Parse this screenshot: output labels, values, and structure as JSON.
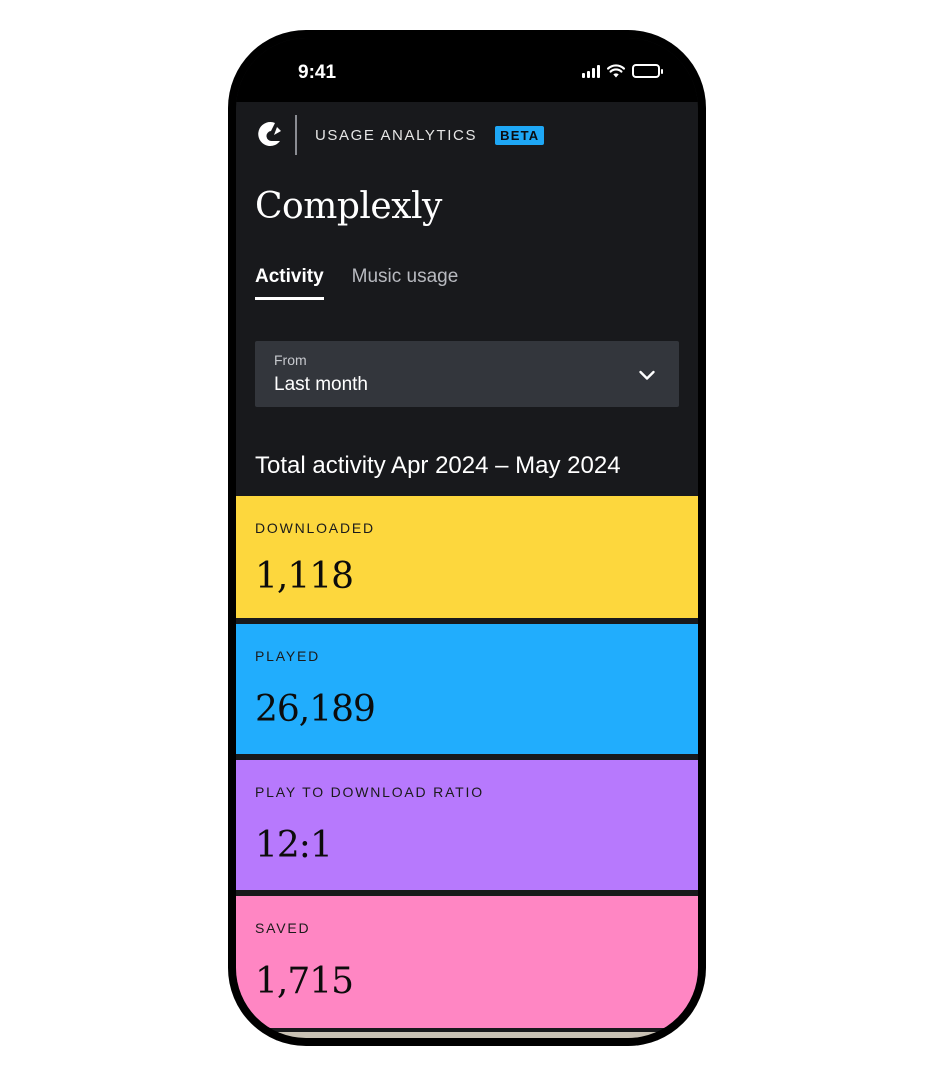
{
  "status_bar": {
    "time": "9:41"
  },
  "header": {
    "section": "USAGE ANALYTICS",
    "badge": "BETA"
  },
  "app": {
    "title": "Complexly"
  },
  "tabs": [
    {
      "label": "Activity",
      "active": true
    },
    {
      "label": "Music usage",
      "active": false
    }
  ],
  "filter": {
    "label": "From",
    "value": "Last month"
  },
  "summary": {
    "heading": "Total activity Apr 2024 – May 2024"
  },
  "stats": [
    {
      "label": "DOWNLOADED",
      "value": "1,118",
      "color": "#fdd73d"
    },
    {
      "label": "PLAYED",
      "value": "26,189",
      "color": "#21adfd"
    },
    {
      "label": "PLAY TO DOWNLOAD RATIO",
      "value": "12:1",
      "color": "#b779fd"
    },
    {
      "label": "SAVED",
      "value": "1,715",
      "color": "#ff86c3"
    }
  ],
  "colors": {
    "background": "#18191c",
    "dropdown": "#33363c",
    "beta": "#1ea7f5"
  },
  "icons": [
    "logo-icon",
    "chevron-down-icon",
    "signal-icon",
    "wifi-icon",
    "battery-icon"
  ]
}
